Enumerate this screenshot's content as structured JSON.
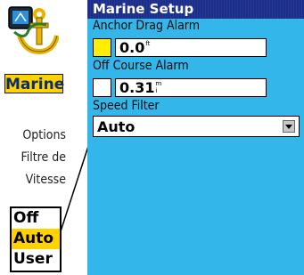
{
  "app": {
    "icon": "anchor-icon",
    "label": "Marine"
  },
  "caption": {
    "line1": "Options",
    "line2": "Filtre de",
    "line3": "Vitesse"
  },
  "speed_filter_options": [
    {
      "label": "Off",
      "selected": false
    },
    {
      "label": "Auto",
      "selected": true
    },
    {
      "label": "User",
      "selected": false
    }
  ],
  "screen": {
    "title": "Marine Setup",
    "anchor_drag_alarm": {
      "label": "Anchor Drag Alarm",
      "value": "0.0",
      "unit": "ft",
      "swatch_color": "#ffee00"
    },
    "off_course_alarm": {
      "label": "Off Course Alarm",
      "value": "0.31",
      "unit": "mi",
      "swatch_color": "#ffffff"
    },
    "speed_filter": {
      "label": "Speed Filter",
      "value": "Auto"
    }
  },
  "colors": {
    "screen_bg": "#33b7ea",
    "title_bar": "#1c2e8c",
    "highlight": "#ffd200"
  }
}
